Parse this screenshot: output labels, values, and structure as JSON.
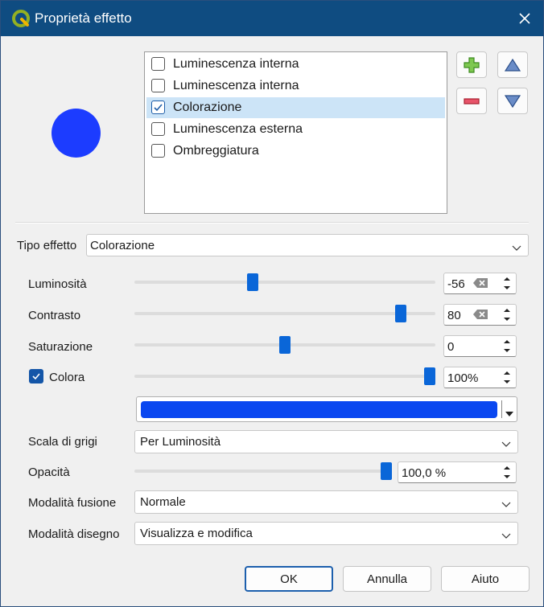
{
  "window": {
    "title": "Proprietà effetto"
  },
  "effects": [
    {
      "label": "Luminescenza interna",
      "checked": false,
      "selected": false
    },
    {
      "label": "Luminescenza interna",
      "checked": false,
      "selected": false
    },
    {
      "label": "Colorazione",
      "checked": true,
      "selected": true
    },
    {
      "label": "Luminescenza esterna",
      "checked": false,
      "selected": false
    },
    {
      "label": "Ombreggiatura",
      "checked": false,
      "selected": false
    }
  ],
  "effect_type": {
    "label": "Tipo effetto",
    "value": "Colorazione"
  },
  "luminosita": {
    "label": "Luminosità",
    "value": "-56",
    "slider": 0.39
  },
  "contrasto": {
    "label": "Contrasto",
    "value": "80",
    "slider": 0.9
  },
  "saturazione": {
    "label": "Saturazione",
    "value": "0",
    "slider": 0.5
  },
  "colora": {
    "label": "Colora",
    "checked": true,
    "value": "100%",
    "slider": 1.0,
    "color": "#0a47f0"
  },
  "scala_grigi": {
    "label": "Scala di grigi",
    "value": "Per Luminosità"
  },
  "opacita": {
    "label": "Opacità",
    "value": "100,0 %",
    "slider": 1.0
  },
  "fusione": {
    "label": "Modalità fusione",
    "value": "Normale"
  },
  "disegno": {
    "label": "Modalità disegno",
    "value": "Visualizza e modifica"
  },
  "buttons": {
    "ok": "OK",
    "cancel": "Annulla",
    "help": "Aiuto"
  },
  "colors": {
    "titlebar": "#0f4c81",
    "accent": "#0a66d8",
    "preview": "#1c3cff"
  }
}
